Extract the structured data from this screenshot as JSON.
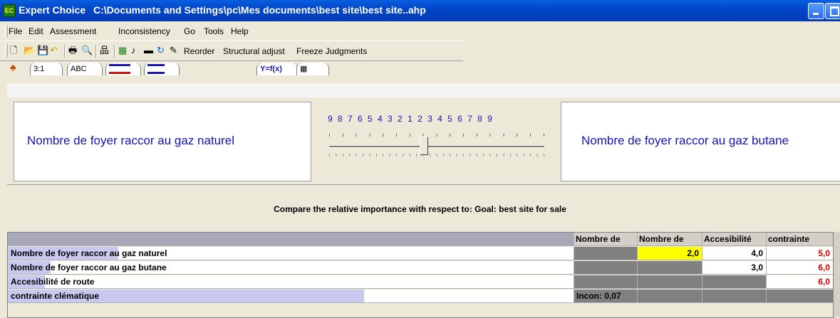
{
  "window": {
    "app_name": "Expert Choice",
    "path": "C:\\Documents and Settings\\pc\\Mes documents\\best site\\best site..ahp"
  },
  "menu": [
    "File",
    "Edit",
    "Assessment",
    "Inconsistency",
    "Go",
    "Tools",
    "Help"
  ],
  "toolbar": {
    "reorder": "Reorder",
    "structural_adjust": "Structural adjust",
    "freeze": "Freeze Judgments"
  },
  "tabs": [
    "3:1",
    "ABC",
    "Y=f(x)"
  ],
  "comparison": {
    "left_label": "Nombre de foyer raccor au gaz naturel",
    "right_label": "Nombre de foyer raccor au gaz butane",
    "scale": "9 8 7 6 5 4 3 2 1 2 3 4 5 6 7 8 9",
    "instruction": "Compare the relative importance  with respect to: Goal: best site for sale"
  },
  "matrix": {
    "headers": [
      "Nombre de",
      "Nombre de",
      "Accesibilité",
      "contrainte"
    ],
    "rows": [
      {
        "label": "Nombre de foyer raccor au gaz naturel",
        "cells": [
          "",
          "2,0",
          "4,0",
          "5,0"
        ]
      },
      {
        "label": "Nombre de foyer raccor au gaz butane",
        "cells": [
          "",
          "",
          "3,0",
          "6,0"
        ]
      },
      {
        "label": "Accesibilité de route",
        "cells": [
          "",
          "",
          "",
          "6,0"
        ]
      },
      {
        "label": "contrainte clématique",
        "cells": [
          "Incon: 0,07",
          "",
          "",
          ""
        ]
      }
    ]
  },
  "colors": {
    "inverse_judgment": "#e00000",
    "selected_cell": "#ffff00"
  }
}
